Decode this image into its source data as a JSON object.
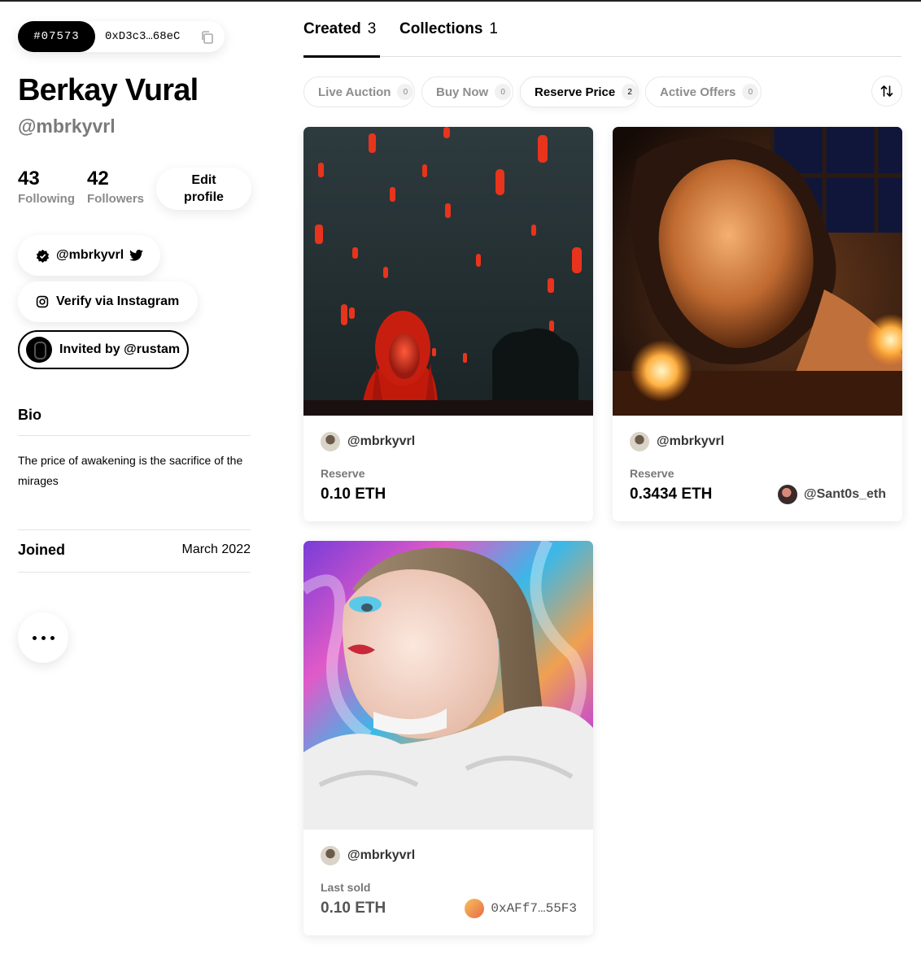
{
  "profile": {
    "number": "#07573",
    "address": "0xD3c3…68eC",
    "name": "Berkay Vural",
    "handle": "@mbrkyvrl",
    "following_count": "43",
    "following_label": "Following",
    "followers_count": "42",
    "followers_label": "Followers",
    "edit_label": "Edit profile",
    "twitter_handle": "@mbrkyvrl",
    "instagram_label": "Verify via Instagram",
    "invited_label": "Invited by @rustam",
    "bio_title": "Bio",
    "bio_text": "The price of awakening is the sacrifice of the mirages",
    "joined_label": "Joined",
    "joined_value": "March 2022"
  },
  "tabs": [
    {
      "label": "Created",
      "count": "3"
    },
    {
      "label": "Collections",
      "count": "1"
    }
  ],
  "filters": [
    {
      "label": "Live Auction",
      "count": "0"
    },
    {
      "label": "Buy Now",
      "count": "0"
    },
    {
      "label": "Reserve Price",
      "count": "2"
    },
    {
      "label": "Active Offers",
      "count": "0"
    }
  ],
  "cards": [
    {
      "creator": "@mbrkyvrl",
      "price_label": "Reserve",
      "price": "0.10 ETH",
      "owner": ""
    },
    {
      "creator": "@mbrkyvrl",
      "price_label": "Reserve",
      "price": "0.3434 ETH",
      "owner": "@Sant0s_eth"
    },
    {
      "creator": "@mbrkyvrl",
      "price_label": "Last sold",
      "price": "0.10 ETH",
      "owner": "0xAFf7…55F3"
    }
  ],
  "icons": {
    "copy": "copy-icon",
    "verified": "verified-badge-icon",
    "twitter": "twitter-icon",
    "instagram": "instagram-icon",
    "sort": "sort-arrows-icon",
    "more": "more-dots-icon"
  }
}
